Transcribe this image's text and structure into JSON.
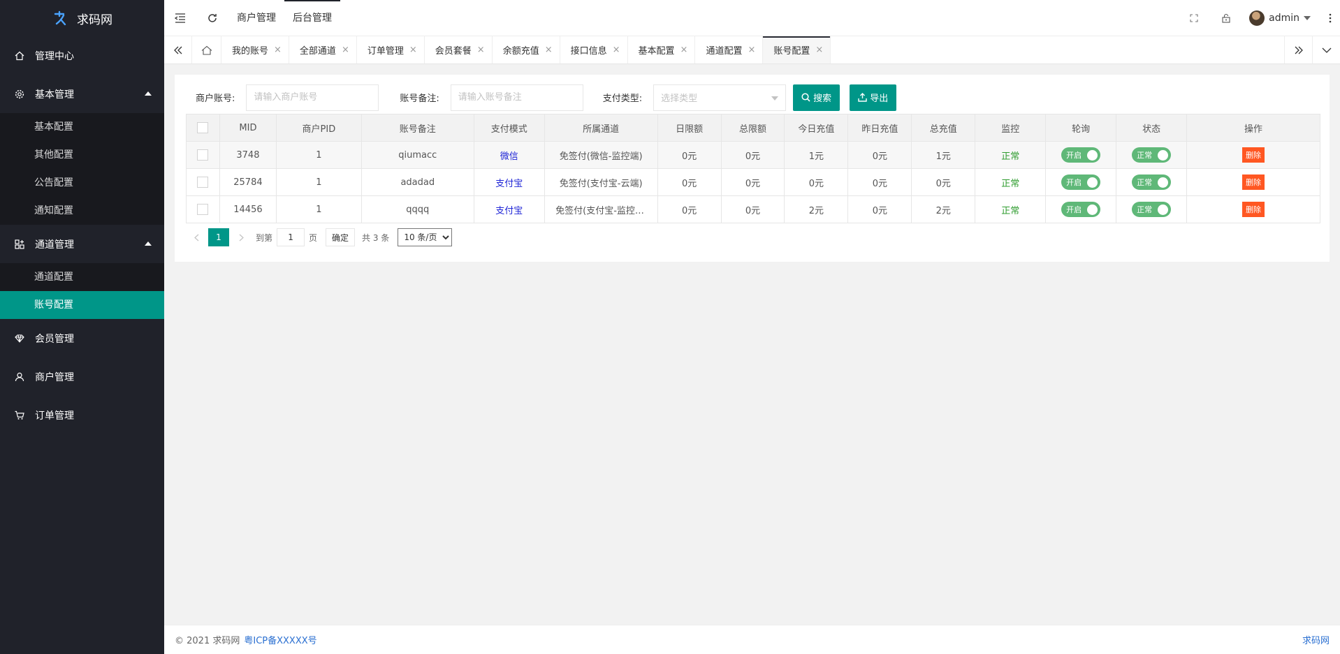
{
  "brand": {
    "name": "求码网",
    "accent": "#009688"
  },
  "sidebar": {
    "groups": [
      {
        "label": "管理中心",
        "icon": "home-icon",
        "items": []
      },
      {
        "label": "基本管理",
        "icon": "gear-icon",
        "expanded": true,
        "items": [
          {
            "label": "基本配置"
          },
          {
            "label": "其他配置"
          },
          {
            "label": "公告配置"
          },
          {
            "label": "通知配置"
          }
        ]
      },
      {
        "label": "通道管理",
        "icon": "apps-icon",
        "expanded": true,
        "items": [
          {
            "label": "通道配置"
          },
          {
            "label": "账号配置",
            "active": true
          }
        ]
      },
      {
        "label": "会员管理",
        "icon": "diamond-icon",
        "items": []
      },
      {
        "label": "商户管理",
        "icon": "user-icon",
        "items": []
      },
      {
        "label": "订单管理",
        "icon": "cart-icon",
        "items": []
      }
    ]
  },
  "header": {
    "links": [
      {
        "label": "商户管理"
      },
      {
        "label": "后台管理",
        "active": true
      }
    ],
    "user": {
      "name": "admin"
    }
  },
  "tabs": [
    {
      "label": "我的账号"
    },
    {
      "label": "全部通道"
    },
    {
      "label": "订单管理"
    },
    {
      "label": "会员套餐"
    },
    {
      "label": "余额充值"
    },
    {
      "label": "接口信息"
    },
    {
      "label": "基本配置"
    },
    {
      "label": "通道配置"
    },
    {
      "label": "账号配置",
      "active": true
    }
  ],
  "tab_close": "×",
  "filter": {
    "merchant_label": "商户账号:",
    "merchant_placeholder": "请输入商户账号",
    "remark_label": "账号备注:",
    "remark_placeholder": "请输入账号备注",
    "paytype_label": "支付类型:",
    "paytype_placeholder": "选择类型",
    "search_label": "搜索",
    "export_label": "导出"
  },
  "table": {
    "columns": [
      "MID",
      "商户PID",
      "账号备注",
      "支付模式",
      "所属通道",
      "日限额",
      "总限额",
      "今日充值",
      "昨日充值",
      "总充值",
      "监控",
      "轮询",
      "状态",
      "操作"
    ],
    "rows": [
      {
        "mid": "3748",
        "pid": "1",
        "remark": "qiumacc",
        "mode": "微信",
        "channel": "免签付(微信-监控端)",
        "day_limit": "0元",
        "total_limit": "0元",
        "today": "1元",
        "yesterday": "0元",
        "total": "1元",
        "monitor": "正常",
        "poll": "开启",
        "status": "正常",
        "action": "删除"
      },
      {
        "mid": "25784",
        "pid": "1",
        "remark": "adadad",
        "mode": "支付宝",
        "channel": "免签付(支付宝-云端)",
        "day_limit": "0元",
        "total_limit": "0元",
        "today": "0元",
        "yesterday": "0元",
        "total": "0元",
        "monitor": "正常",
        "poll": "开启",
        "status": "正常",
        "action": "删除"
      },
      {
        "mid": "14456",
        "pid": "1",
        "remark": "qqqq",
        "mode": "支付宝",
        "channel": "免签付(支付宝-监控端)",
        "day_limit": "0元",
        "total_limit": "0元",
        "today": "2元",
        "yesterday": "0元",
        "total": "2元",
        "monitor": "正常",
        "poll": "开启",
        "status": "正常",
        "action": "删除"
      }
    ]
  },
  "pager": {
    "current": "1",
    "goto_label": "到第",
    "page_input": "1",
    "page_unit": "页",
    "confirm": "确定",
    "total": "共 3 条",
    "size_selected": "10 条/页"
  },
  "footer": {
    "copyright": "© 2021 求码网",
    "icp": "粤ICP备XXXXX号",
    "right": "求码网"
  }
}
